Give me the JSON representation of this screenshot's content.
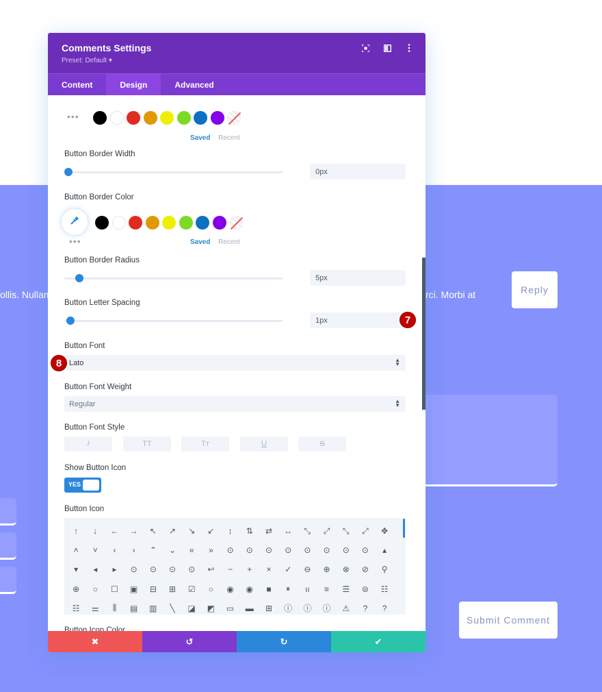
{
  "background": {
    "text_left": "ollis. Nullam",
    "text_right": "rci. Morbi at",
    "reply_label": "Reply",
    "submit_label": "Submit Comment"
  },
  "modal": {
    "title": "Comments Settings",
    "preset": "Preset: Default ▾",
    "header_icons": [
      "focus-icon",
      "split-view-icon",
      "more-options-icon"
    ],
    "tabs": [
      {
        "label": "Content",
        "active": false
      },
      {
        "label": "Design",
        "active": true
      },
      {
        "label": "Advanced",
        "active": false
      }
    ]
  },
  "colors": {
    "swatches": [
      "#000000",
      "#ffffff",
      "#e02b20",
      "#e09900",
      "#edf000",
      "#7cda24",
      "#0c71c3",
      "#8300e9",
      "none"
    ],
    "saved_label": "Saved",
    "recent_label": "Recent",
    "more_label": "•••"
  },
  "settings": {
    "border_width": {
      "label": "Button Border Width",
      "value": "0px",
      "slider_fraction": 0.0
    },
    "border_color": {
      "label": "Button Border Color"
    },
    "border_radius": {
      "label": "Button Border Radius",
      "value": "5px",
      "slider_fraction": 0.05
    },
    "letter_spacing": {
      "label": "Button Letter Spacing",
      "value": "1px",
      "slider_fraction": 0.01
    },
    "font": {
      "label": "Button Font",
      "value": "Lato"
    },
    "font_weight": {
      "label": "Button Font Weight",
      "value": "Regular"
    },
    "font_style": {
      "label": "Button Font Style",
      "options": [
        "I",
        "TT",
        "Tт",
        "U",
        "S"
      ]
    },
    "show_icon": {
      "label": "Show Button Icon",
      "value": "YES",
      "on": true
    },
    "icon": {
      "label": "Button Icon"
    },
    "icon_color": {
      "label": "Button Icon Color"
    }
  },
  "icon_grid": [
    "↑",
    "↓",
    "←",
    "→",
    "↖",
    "↗",
    "↘",
    "↙",
    "↕",
    "⇅",
    "⇄",
    "↔",
    "⤡",
    "⤢",
    "⤡",
    "⤢",
    "✥",
    "˄",
    "˅",
    "‹",
    "›",
    "⌃",
    "⌄",
    "«",
    "»",
    "⊙",
    "⊙",
    "⊙",
    "⊙",
    "⊙",
    "⊙",
    "⊙",
    "⊙",
    "▴",
    "▾",
    "◂",
    "▸",
    "⊙",
    "⊙",
    "⊙",
    "⊙",
    "↩",
    "−",
    "+",
    "×",
    "✓",
    "⊖",
    "⊕",
    "⊗",
    "⊘",
    "⚲",
    "⊕",
    "○",
    "☐",
    "▣",
    "⊟",
    "⊞",
    "☑",
    "○",
    "◉",
    "◉",
    "■",
    "⏸",
    "ıı",
    "≡",
    "☰",
    "⊜",
    "☷",
    "☷",
    "⚌",
    "⫼",
    "▤",
    "▥",
    "╲",
    "◪",
    "◩",
    "▭",
    "▬",
    "⊞",
    "ⓘ",
    "ⓘ",
    "ⓘ",
    "⚠",
    "?",
    "?"
  ],
  "badges": {
    "seven": "7",
    "eight": "8"
  },
  "footer": {
    "cancel_icon": "✖",
    "undo_icon": "↺",
    "redo_icon": "↻",
    "save_icon": "✔"
  }
}
